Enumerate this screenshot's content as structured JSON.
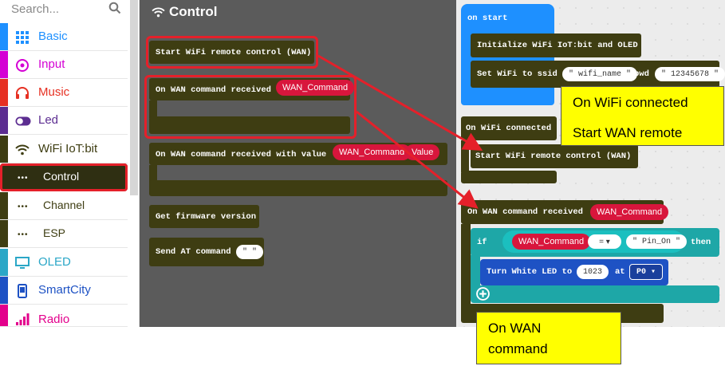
{
  "search": {
    "placeholder": "Search..."
  },
  "sidebar": {
    "items": [
      {
        "label": "Basic",
        "color": "#1e90ff",
        "icon": "grid-icon"
      },
      {
        "label": "Input",
        "color": "#d400d4",
        "icon": "target-icon"
      },
      {
        "label": "Music",
        "color": "#e63022",
        "icon": "headphones-icon"
      },
      {
        "label": "Led",
        "color": "#5c2d91",
        "icon": "toggle-icon"
      },
      {
        "label": "WiFi IoT:bit",
        "color": "#3e3d12",
        "icon": "wifi-icon"
      },
      {
        "label": "Control",
        "color": "#3e3d12",
        "icon": "dots-icon"
      },
      {
        "label": "Channel",
        "color": "#3e3d12",
        "icon": "dots-icon"
      },
      {
        "label": "ESP",
        "color": "#3e3d12",
        "icon": "dots-icon"
      },
      {
        "label": "OLED",
        "color": "#2ba7c7",
        "icon": "monitor-icon"
      },
      {
        "label": "SmartCity",
        "color": "#1e52c4",
        "icon": "phone-icon"
      },
      {
        "label": "Radio",
        "color": "#e3008c",
        "icon": "signal-icon"
      }
    ]
  },
  "flyout": {
    "title": "Control",
    "blocks": {
      "start_wan": "Start WiFi remote control (WAN)",
      "on_wan_cmd": "On WAN command received",
      "on_wan_cmd_var": "WAN_Command",
      "on_wan_value": "On WAN command received with value",
      "on_wan_value_var1": "WAN_Command",
      "on_wan_value_var2": "Value",
      "get_fw": "Get firmware version",
      "send_at": "Send AT command",
      "send_at_str": "\"   \""
    }
  },
  "workspace": {
    "on_start": "on start",
    "init": "Initialize WiFi IoT:bit and OLED",
    "set_wifi": "Set WiFi to ssid",
    "ssid": "\" wifi_name \"",
    "pwd_label": "pwd",
    "pwd": "\" 12345678 \"",
    "on_wifi_connected": "On WiFi connected",
    "start_wan": "Start WiFi remote control (WAN)",
    "on_wan_cmd": "On WAN command received",
    "on_wan_cmd_var": "WAN_Command",
    "if_label": "if",
    "if_var": "WAN_Command",
    "op": "= ▾",
    "cmp_str": "\" Pin_On \"",
    "then_label": "then",
    "led_label": "Turn White LED to",
    "led_value": "1023",
    "at_label": "at",
    "pin": "P0 ▾"
  },
  "notes": {
    "wifi_connected_line1": "On WiFi connected",
    "wifi_connected_line2": "Start WAN remote",
    "wan_command_line1": "On WAN",
    "wan_command_line2": "command"
  }
}
